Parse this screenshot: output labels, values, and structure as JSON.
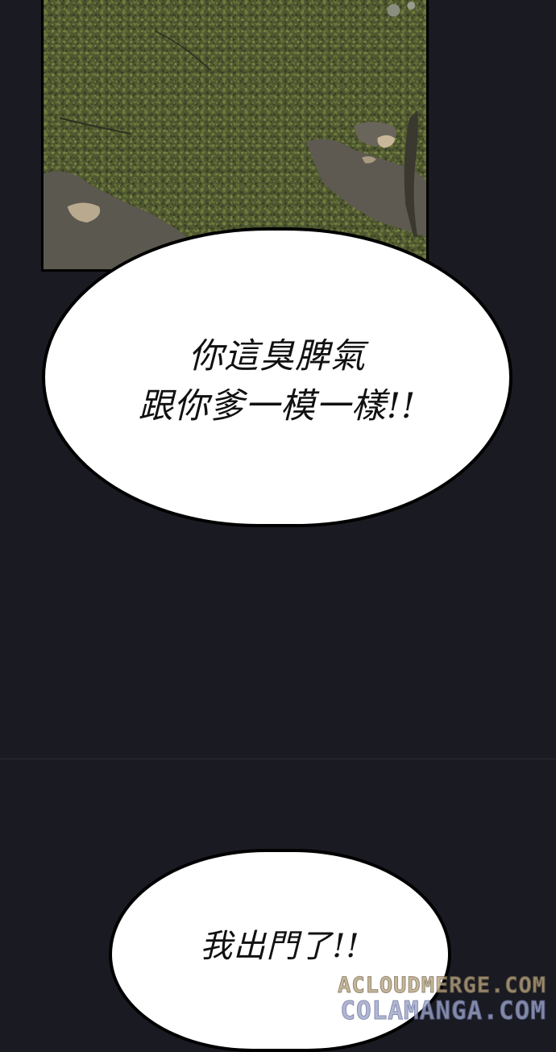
{
  "panels": {
    "top_panel": {
      "scene": "foliage",
      "colors": {
        "dark_green": "#3f4726",
        "mid_green": "#56602f",
        "light_green": "#6f7a3e",
        "shadow": "#2f3328",
        "ground_gray": "#5e5a52",
        "patch_light": "#b9a98e"
      }
    }
  },
  "bubbles": {
    "first": {
      "line1": "你這臭脾氣",
      "line2": "跟你爹一模一樣!!"
    },
    "second": {
      "line1": "我出門了!!"
    }
  },
  "watermarks": {
    "line1": "ACLOUDMERGE.COM",
    "line2": "COLAMANGA.COM"
  },
  "colors": {
    "background": "#1a1a22",
    "bubble_fill": "#ffffff",
    "bubble_border": "#000000"
  }
}
